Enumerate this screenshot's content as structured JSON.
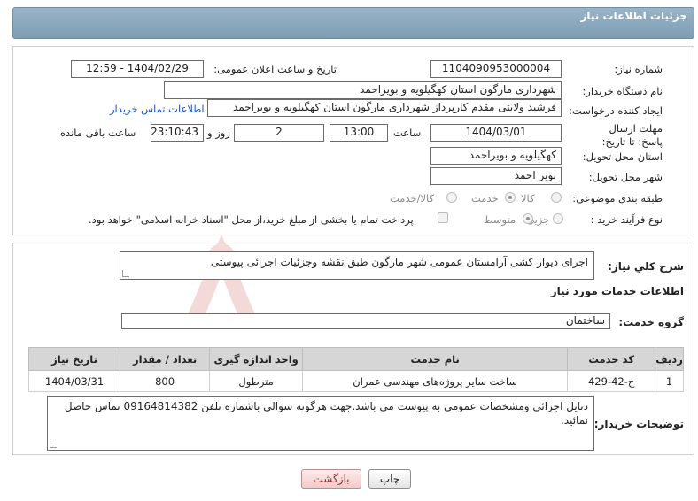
{
  "header": {
    "title": "جزئیات اطلاعات نیاز"
  },
  "form": {
    "need_number": {
      "label": "شماره نیاز:",
      "value": "1104090953000004"
    },
    "announce_datetime": {
      "label": "تاریخ و ساعت اعلان عمومی:",
      "value": "1404/02/29 - 12:59"
    },
    "buyer_org": {
      "label": "نام دستگاه خریدار:",
      "value": "شهرداری مارگون استان کهگیلویه و بویراحمد"
    },
    "requester": {
      "label": "ایجاد کننده درخواست:",
      "value": "فرشید  ولایتی مقدم  کارپرداز شهرداری مارگون استان کهگیلویه و بویراحمد",
      "contact_link": "اطلاعات تماس خریدار"
    },
    "deadline": {
      "label": "مهلت ارسال پاسخ: تا تاریخ:",
      "date": "1404/03/01",
      "time_label": "ساعت",
      "time": "13:00",
      "days": "2",
      "days_label": "روز و",
      "remaining": "23:10:43",
      "remaining_label": "ساعت باقی مانده"
    },
    "delivery_province": {
      "label": "استان محل تحویل:",
      "value": "کهگیلویه و بویراحمد"
    },
    "delivery_city": {
      "label": "شهر محل تحویل:",
      "value": "بویر احمد"
    },
    "category": {
      "label": "طبقه بندی موضوعی:",
      "options": [
        "کالا",
        "خدمت",
        "کالا/خدمت"
      ],
      "selected": "خدمت"
    },
    "process_type": {
      "label": "نوع فرآیند خرید :",
      "options": [
        "جزیی",
        "متوسط"
      ],
      "selected": "متوسط",
      "payment_note": "پرداخت تمام یا بخشی از مبلغ خرید،از محل \"اسناد خزانه اسلامی\" خواهد بود."
    }
  },
  "details": {
    "summary_label": "شرح کلي نیاز:",
    "summary_value": "اجرای دیوار کشی آرامستان عمومی شهر مارگون طبق نقشه وجزئیات اجرائی پیوستی",
    "services_title": "اطلاعات خدمات مورد نیاز",
    "service_group_label": "گروه خدمت:",
    "service_group_value": "ساختمان",
    "table": {
      "headers": [
        "ردیف",
        "کد خدمت",
        "نام خدمت",
        "واحد اندازه گیری",
        "تعداد / مقدار",
        "تاریخ نیاز"
      ],
      "rows": [
        [
          "1",
          "ج-42-429",
          "ساخت سایر پروژه‌های مهندسی عمران",
          "مترطول",
          "800",
          "1404/03/31"
        ]
      ]
    },
    "buyer_notes_label": "توضیحات خریدار:",
    "buyer_notes_value": "دتایل اجرائی ومشخصات عمومی به پیوست می باشد.جهت هرگونه سوالی باشماره تلفن 09164814382 تماس حاصل نمائید."
  },
  "buttons": {
    "print": "چاپ",
    "back": "بازگشت"
  },
  "colors": {
    "header": "#8aa6bb",
    "link": "#1a58b4",
    "table_header": "#d6d6d6"
  },
  "watermark_text": "AriaTender.neT"
}
